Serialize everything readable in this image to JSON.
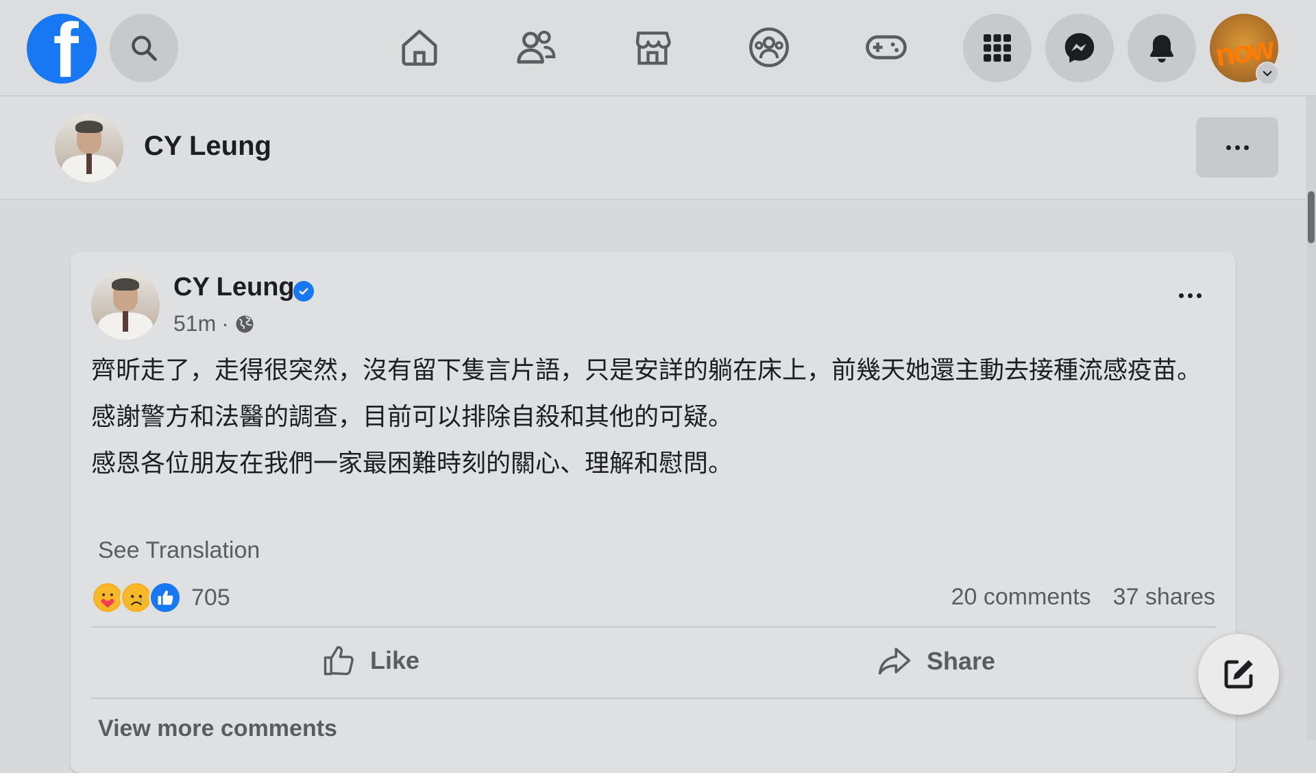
{
  "topbar": {
    "logo_letter": "f",
    "icons": {
      "search": "search-icon",
      "home": "home-icon",
      "friends": "friends-icon",
      "marketplace": "marketplace-icon",
      "groups": "groups-icon",
      "gaming": "gaming-icon",
      "menu": "grid-menu-icon",
      "messenger": "messenger-icon",
      "notifications": "bell-icon",
      "account": "account-avatar"
    },
    "account_avatar_text": "now"
  },
  "subheader": {
    "name": "CY Leung"
  },
  "post": {
    "author": "CY Leung",
    "time": "51m",
    "separator": "·",
    "paragraphs": [
      "齊昕走了，走得很突然，沒有留下隻言片語，只是安詳的躺在床上，前幾天她還主動去接種流感疫苗。",
      "感謝警方和法醫的調查，目前可以排除自殺和其他的可疑。",
      "感恩各位朋友在我們一家最困難時刻的關心、理解和慰問。"
    ],
    "see_translation": "See Translation",
    "reaction_count": "705",
    "comments": "20 comments",
    "shares": "37 shares",
    "like_label": "Like",
    "share_label": "Share",
    "view_more": "View more comments"
  },
  "colors": {
    "brand_blue": "#1877f2",
    "background": "#d8d9db"
  }
}
